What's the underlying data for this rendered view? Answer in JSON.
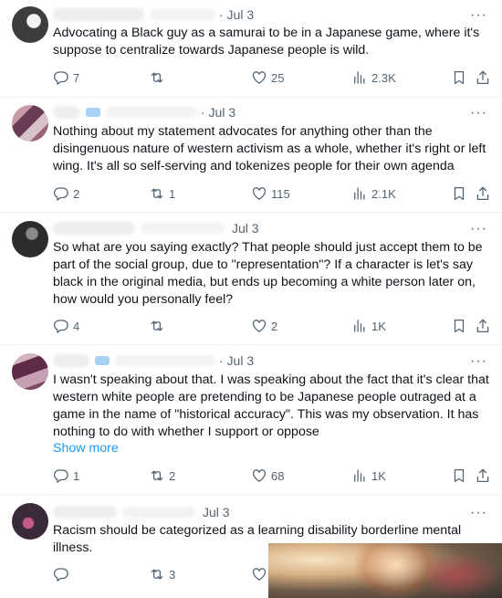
{
  "tweets": [
    {
      "date": "· Jul 3",
      "text": "Advocating a Black guy as a samurai to be in a Japanese game, where it's suppose to  centralize towards Japanese people is wild.",
      "replies": "7",
      "retweets": "",
      "likes": "25",
      "views": "2.3K"
    },
    {
      "date": "· Jul 3",
      "text": "Nothing about my statement advocates for anything other than the disingenuous nature of western activism as a whole, whether it's right or left wing. It's all so self-serving and tokenizes people for their own agenda",
      "replies": "2",
      "retweets": "1",
      "likes": "115",
      "views": "2.1K"
    },
    {
      "date": "Jul 3",
      "text": "So what are you saying exactly? That people should just accept them to be part of the social group, due to \"representation\"? If a character is let's say black in the original media, but ends up becoming a white person later on, how would you personally feel?",
      "replies": "4",
      "retweets": "",
      "likes": "2",
      "views": "1K"
    },
    {
      "date": "· Jul 3",
      "text": "I wasn't speaking about that. I was speaking about the fact that it's clear that western white people are pretending to be Japanese people outraged at a game in the name of \"historical accuracy\". This was my observation. It has nothing to do with whether I support or oppose",
      "show_more": "Show more",
      "replies": "1",
      "retweets": "2",
      "likes": "68",
      "views": "1K"
    },
    {
      "date": "Jul 3",
      "text": "Racism should be categorized as a learning disability borderline mental illness.",
      "replies": "",
      "retweets": "3"
    }
  ],
  "icons": {
    "reply": "reply-icon",
    "retweet": "retweet-icon",
    "like": "heart-icon",
    "views": "analytics-icon",
    "bookmark": "bookmark-icon",
    "share": "share-icon",
    "more": "more-icon"
  },
  "colors": {
    "link": "#1d9bf0",
    "muted": "#536471",
    "text": "#0f1419"
  },
  "ui": {
    "more_glyph": "···"
  }
}
